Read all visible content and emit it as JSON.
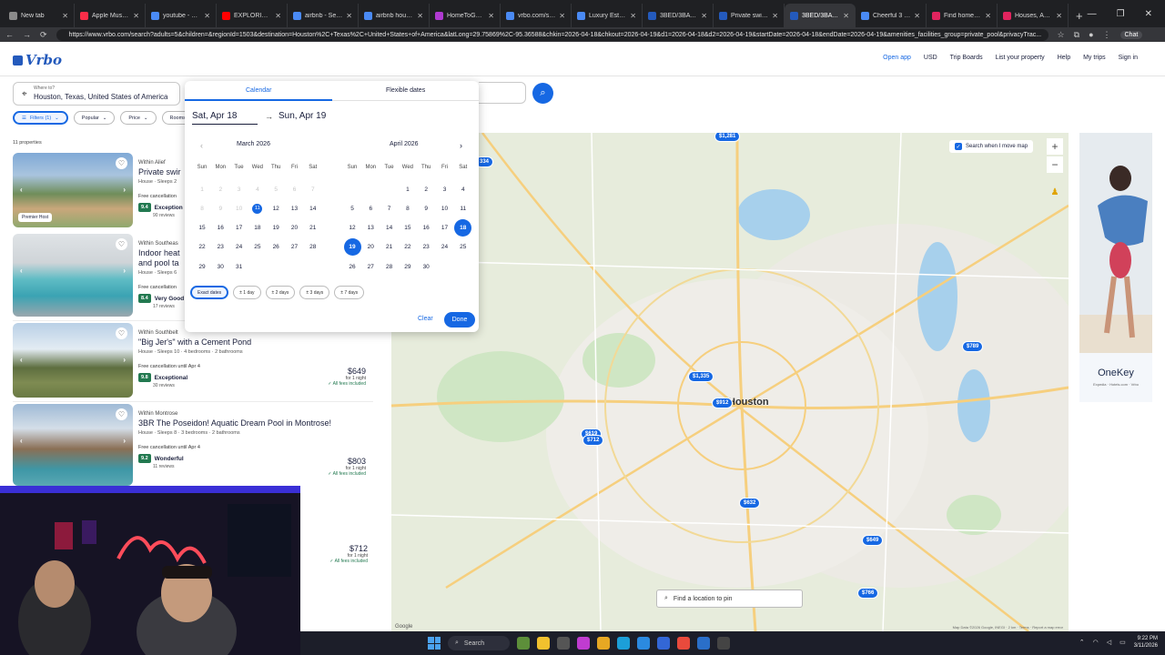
{
  "browser": {
    "tabs": [
      {
        "title": "New tab",
        "color": "#8a8a8a"
      },
      {
        "title": "Apple Music - We",
        "color": "#fa2d48"
      },
      {
        "title": "youtube - Search",
        "color": "#4a8af4"
      },
      {
        "title": "EXPLORING CHE",
        "color": "#ff0000"
      },
      {
        "title": "airbnb - Search",
        "color": "#4a8af4"
      },
      {
        "title": "airbnb houston te",
        "color": "#4a8af4"
      },
      {
        "title": "HomeToGo | Vaca",
        "color": "#b03ad1"
      },
      {
        "title": "vrbo.com/search?",
        "color": "#4a8af4"
      },
      {
        "title": "Luxury Estate with",
        "color": "#4a8af4"
      },
      {
        "title": "3BED/3BATH in H",
        "color": "#245abc"
      },
      {
        "title": "Private swimming",
        "color": "#245abc"
      },
      {
        "title": "3BED/3BATH in H",
        "color": "#245abc"
      },
      {
        "title": "Cheerful 3 bedro",
        "color": "#4a8af4"
      },
      {
        "title": "Find homes near",
        "color": "#e0245e"
      },
      {
        "title": "Houses, Apartme",
        "color": "#e0245e"
      }
    ],
    "active_tab_index": 11,
    "url": "https://www.vrbo.com/search?adults=5&children=&regionId=1503&destination=Houston%2C+Texas%2C+United+States+of+America&latLong=29.75869%2C-95.36588&chkin=2026-04-18&chkout=2026-04-19&d1=2026-04-18&d2=2026-04-19&startDate=2026-04-18&endDate=2026-04-19&amenities_facilities_group=private_pool&privacyTrac...",
    "chat_label": "Chat"
  },
  "header": {
    "logo": "Vrbo",
    "nav": {
      "open_app": "Open app",
      "currency": "USD",
      "trip_boards": "Trip Boards",
      "list_property": "List your property",
      "help": "Help",
      "my_trips": "My trips",
      "sign_in": "Sign in"
    }
  },
  "search": {
    "where_label": "Where to?",
    "where_value": "Houston, Texas, United States of America"
  },
  "filters": [
    "Filters (1)",
    "Popular",
    "Price",
    "Rooms &"
  ],
  "results_count": "11 properties",
  "listings": [
    {
      "location": "Within Alief",
      "title": "Private swir",
      "specs": "House · Sleeps 2",
      "cancel": "Free cancellation",
      "score": "9.4",
      "rating": "Exception",
      "reviews": "90 reviews",
      "badge": "Premier Host",
      "price": "",
      "per_night": "",
      "fees": ""
    },
    {
      "location": "Within Southeas",
      "title": "Indoor heat",
      "title2": "and pool ta",
      "specs": "House · Sleeps 6",
      "cancel": "Free cancellation",
      "score": "8.4",
      "rating": "Very Good",
      "reviews": "17 reviews",
      "badge": "",
      "price": "",
      "per_night": "",
      "fees": ""
    },
    {
      "location": "Within Southbelt",
      "title": "\"Big Jer's\" with a Cement Pond",
      "specs": "House · Sleeps 10 · 4 bedrooms · 2 bathrooms",
      "cancel": "Free cancellation until Apr 4",
      "score": "9.8",
      "rating": "Exceptional",
      "reviews": "30 reviews",
      "badge": "",
      "price": "$649",
      "per_night": "for 1 night",
      "fees": "All fees included"
    },
    {
      "location": "Within Montrose",
      "title": "3BR The Poseidon! Aquatic Dream Pool in Montrose!",
      "specs": "House · Sleeps 8 · 3 bedrooms · 2 bathrooms",
      "cancel": "Free cancellation until Apr 4",
      "score": "9.2",
      "rating": "Wonderful",
      "reviews": "11 reviews",
      "badge": "",
      "price": "$803",
      "per_night": "for 1 night",
      "fees": "All fees included"
    }
  ],
  "hidden_listing_price": {
    "price": "$712",
    "per_night": "for 1 night",
    "fees": "All fees included"
  },
  "calendar": {
    "tabs": [
      "Calendar",
      "Flexible dates"
    ],
    "start_date": "Sat, Apr 18",
    "end_date": "Sun, Apr 19",
    "weekdays": [
      "Sun",
      "Mon",
      "Tue",
      "Wed",
      "Thu",
      "Fri",
      "Sat"
    ],
    "months": [
      {
        "name": "March 2026",
        "first_weekday": 0,
        "days": 31,
        "past_until": 10,
        "today": 11
      },
      {
        "name": "April 2026",
        "first_weekday": 3,
        "days": 30,
        "selected": [
          18,
          19
        ]
      }
    ],
    "flex_options": [
      "Exact dates",
      "± 1 day",
      "± 2 days",
      "± 3 days",
      "± 7 days"
    ],
    "clear": "Clear",
    "done": "Done"
  },
  "map": {
    "search_when_move": "Search when I move map",
    "find_pin_placeholder": "Find a location to pin",
    "city": "Houston",
    "footer": "Map Data ©2026 Google, INEGI · 2 km · Terms · Report a map error",
    "google": "Google",
    "price_markers": [
      "$1,281",
      "334",
      "$789",
      "$1,335",
      "$912",
      "$619",
      "$712",
      "$632",
      "$649",
      "$766"
    ]
  },
  "ad": {
    "brand": "OneKey",
    "sub": "Expedia · Hotels.com · Vrbo"
  },
  "taskbar": {
    "search": "Search",
    "time": "9:22 PM",
    "date": "3/11/2026"
  }
}
